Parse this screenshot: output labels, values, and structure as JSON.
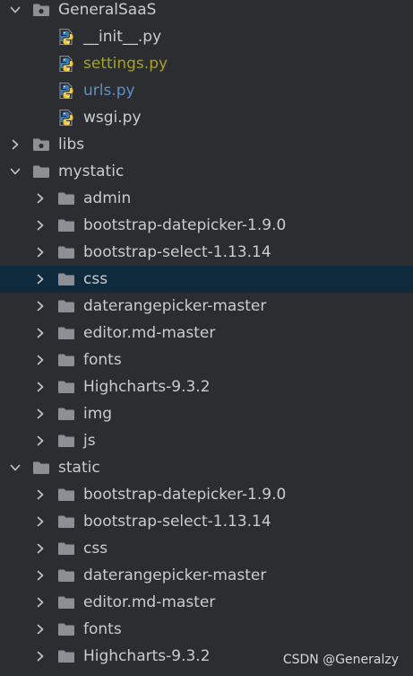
{
  "colors": {
    "background": "#2b2d30",
    "selected_row": "#0f2a3d",
    "text": "#c9ccd1",
    "modified_file": "#a5a323",
    "new_file": "#5d8ec9",
    "folder": "#8c8f94"
  },
  "tree": [
    {
      "label": "GeneralSaaS",
      "depth": 0,
      "kind": "module-folder",
      "expanded": true
    },
    {
      "label": "__init__.py",
      "depth": 1,
      "kind": "python-file"
    },
    {
      "label": "settings.py",
      "depth": 1,
      "kind": "python-file",
      "status": "modified"
    },
    {
      "label": "urls.py",
      "depth": 1,
      "kind": "python-file",
      "status": "changed"
    },
    {
      "label": "wsgi.py",
      "depth": 1,
      "kind": "python-file"
    },
    {
      "label": "libs",
      "depth": 0,
      "kind": "module-folder",
      "expanded": false
    },
    {
      "label": "mystatic",
      "depth": 0,
      "kind": "folder",
      "expanded": true
    },
    {
      "label": "admin",
      "depth": 1,
      "kind": "folder",
      "expanded": false
    },
    {
      "label": "bootstrap-datepicker-1.9.0",
      "depth": 1,
      "kind": "folder",
      "expanded": false
    },
    {
      "label": "bootstrap-select-1.13.14",
      "depth": 1,
      "kind": "folder",
      "expanded": false
    },
    {
      "label": "css",
      "depth": 1,
      "kind": "folder",
      "expanded": false,
      "selected": true
    },
    {
      "label": "daterangepicker-master",
      "depth": 1,
      "kind": "folder",
      "expanded": false
    },
    {
      "label": "editor.md-master",
      "depth": 1,
      "kind": "folder",
      "expanded": false
    },
    {
      "label": "fonts",
      "depth": 1,
      "kind": "folder",
      "expanded": false
    },
    {
      "label": "Highcharts-9.3.2",
      "depth": 1,
      "kind": "folder",
      "expanded": false
    },
    {
      "label": "img",
      "depth": 1,
      "kind": "folder",
      "expanded": false
    },
    {
      "label": "js",
      "depth": 1,
      "kind": "folder",
      "expanded": false
    },
    {
      "label": "static",
      "depth": 0,
      "kind": "folder",
      "expanded": true
    },
    {
      "label": "bootstrap-datepicker-1.9.0",
      "depth": 1,
      "kind": "folder",
      "expanded": false
    },
    {
      "label": "bootstrap-select-1.13.14",
      "depth": 1,
      "kind": "folder",
      "expanded": false
    },
    {
      "label": "css",
      "depth": 1,
      "kind": "folder",
      "expanded": false
    },
    {
      "label": "daterangepicker-master",
      "depth": 1,
      "kind": "folder",
      "expanded": false
    },
    {
      "label": "editor.md-master",
      "depth": 1,
      "kind": "folder",
      "expanded": false
    },
    {
      "label": "fonts",
      "depth": 1,
      "kind": "folder",
      "expanded": false
    },
    {
      "label": "Highcharts-9.3.2",
      "depth": 1,
      "kind": "folder",
      "expanded": false
    },
    {
      "label": "",
      "depth": 1,
      "kind": "folder",
      "expanded": false
    }
  ],
  "watermark": "CSDN @Generalzy"
}
